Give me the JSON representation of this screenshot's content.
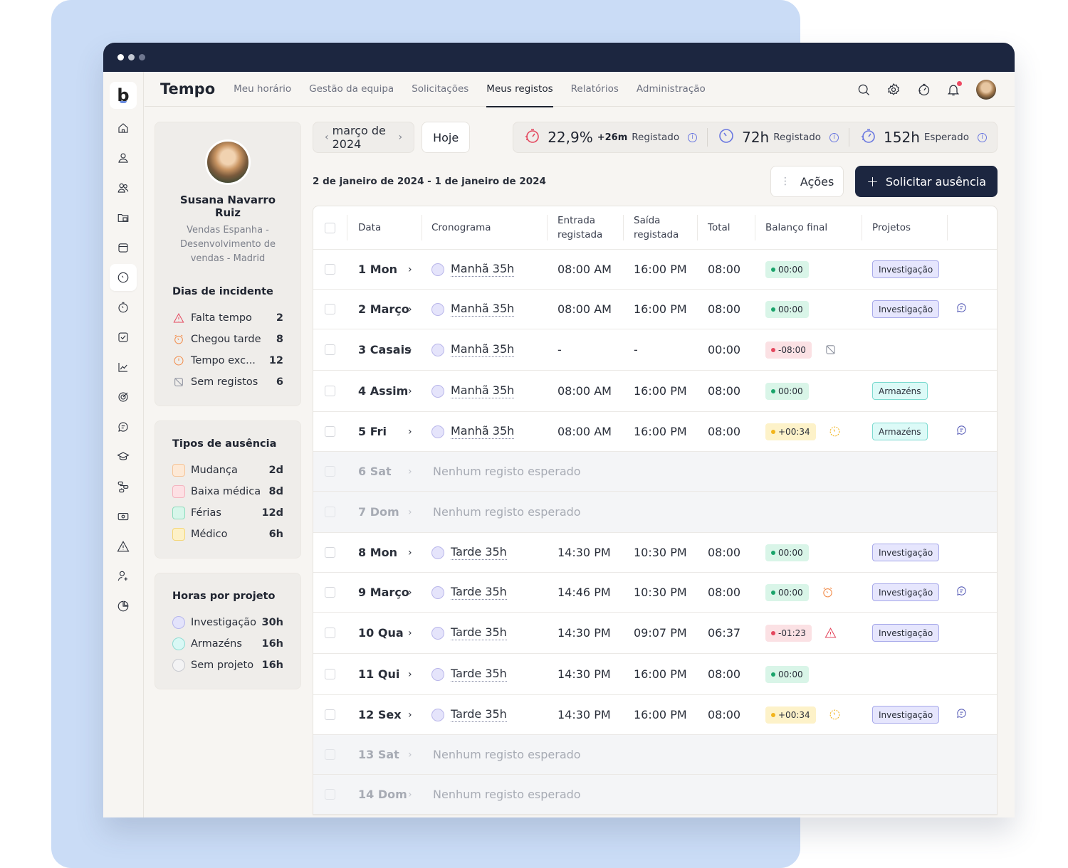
{
  "window": {
    "traffic_lights": [
      "close",
      "minimize",
      "maximize"
    ]
  },
  "brand": {
    "logo_letter": "b"
  },
  "rail": {
    "items": [
      {
        "icon": "home-icon"
      },
      {
        "icon": "user-icon"
      },
      {
        "icon": "users-icon"
      },
      {
        "icon": "folder-icon"
      },
      {
        "icon": "calendar-icon"
      },
      {
        "icon": "clock-icon",
        "active": true
      },
      {
        "icon": "stopwatch-icon"
      },
      {
        "icon": "checkbox-icon"
      },
      {
        "icon": "chart-line-icon"
      },
      {
        "icon": "target-icon"
      },
      {
        "icon": "chat-icon"
      },
      {
        "icon": "graduation-cap-icon"
      },
      {
        "icon": "workflow-icon"
      },
      {
        "icon": "money-icon"
      },
      {
        "icon": "warning-icon"
      },
      {
        "icon": "user-add-icon"
      },
      {
        "icon": "pie-chart-icon"
      }
    ]
  },
  "header": {
    "title": "Tempo",
    "tabs": [
      {
        "label": "Meu horário"
      },
      {
        "label": "Gestão da equipa"
      },
      {
        "label": "Solicitações"
      },
      {
        "label": "Meus registos",
        "active": true
      },
      {
        "label": "Relatórios"
      },
      {
        "label": "Administração"
      }
    ],
    "icons": [
      "search-icon",
      "gear-icon",
      "speedometer-icon",
      "bell-icon",
      "avatar"
    ],
    "notification_badge": true
  },
  "profile": {
    "name": "Susana Navarro Ruiz",
    "department": "Vendas Espanha - Desenvolvimento de vendas - Madrid"
  },
  "incidents": {
    "title": "Dias de incidente",
    "items": [
      {
        "label": "Falta tempo",
        "value": "2",
        "icon": "warning-icon",
        "color": "#e4475e"
      },
      {
        "label": "Chegou tarde",
        "value": "8",
        "icon": "alarm-icon",
        "color": "#f28c4a"
      },
      {
        "label": "Tempo exc...",
        "value": "12",
        "icon": "clock-icon",
        "color": "#f28c4a"
      },
      {
        "label": "Sem registos",
        "value": "6",
        "icon": "no-record-icon",
        "color": "#8a8f9c"
      }
    ]
  },
  "absence_types": {
    "title": "Tipos de ausência",
    "items": [
      {
        "label": "Mudança",
        "value": "2d",
        "fill": "#fde9d6",
        "border": "#f5c59a"
      },
      {
        "label": "Baixa médica",
        "value": "8d",
        "fill": "#fde0e4",
        "border": "#f4b4bf"
      },
      {
        "label": "Férias",
        "value": "12d",
        "fill": "#d7f6ea",
        "border": "#8fdcbe"
      },
      {
        "label": "Médico",
        "value": "6h",
        "fill": "#fdf1c7",
        "border": "#f4d678"
      }
    ]
  },
  "project_hours": {
    "title": "Horas por projeto",
    "items": [
      {
        "label": "Investigação",
        "value": "30h",
        "fill": "#e3e3fb",
        "border": "#b6b6ec"
      },
      {
        "label": "Armazéns",
        "value": "16h",
        "fill": "#d9f8f5",
        "border": "#8fdcd3"
      },
      {
        "label": "Sem projeto",
        "value": "16h",
        "fill": "#f3f3f4",
        "border": "#c8cad0"
      }
    ]
  },
  "toolbar": {
    "month": "março de 2024",
    "today_label": "Hoje",
    "range": "2 de janeiro de 2024 - 1 de janeiro de 2024",
    "actions_label": "Ações",
    "request_label": "Solicitar ausência"
  },
  "stats": [
    {
      "value": "22,9%",
      "delta": "+26m",
      "label": "Registado",
      "icon_color": "#e4475e"
    },
    {
      "value": "72h",
      "label": "Registado",
      "icon_color": "#6a78e0"
    },
    {
      "value": "152h",
      "label": "Esperado",
      "icon_color": "#6a78e0"
    }
  ],
  "table": {
    "columns": [
      "Data",
      "Cronograma",
      "Entrada registada",
      "Saída registada",
      "Total",
      "Balanço final",
      "Projetos"
    ],
    "rows": [
      {
        "date": "1 Mon",
        "schedule": "Manhã 35h",
        "in": "08:00 AM",
        "out": "16:00 PM",
        "total": "08:00",
        "balance": "00:00",
        "bal_type": "ok",
        "project": "Investigação",
        "proj_type": "inv"
      },
      {
        "date": "2 Março",
        "schedule": "Manhã 35h",
        "in": "08:00 AM",
        "out": "16:00 PM",
        "total": "08:00",
        "balance": "00:00",
        "bal_type": "ok",
        "project": "Investigação",
        "proj_type": "inv",
        "comment": true
      },
      {
        "date": "3 Casais",
        "schedule": "Manhã 35h",
        "in": "-",
        "out": "-",
        "total": "00:00",
        "balance": "-08:00",
        "bal_type": "neg",
        "incident": "no-record",
        "tall": true
      },
      {
        "date": "4 Assim",
        "schedule": "Manhã 35h",
        "in": "08:00 AM",
        "out": "16:00 PM",
        "total": "08:00",
        "balance": "00:00",
        "bal_type": "ok",
        "project": "Armazéns",
        "proj_type": "arm",
        "tall": true
      },
      {
        "date": "5 Fri",
        "schedule": "Manhã 35h",
        "in": "08:00 AM",
        "out": "16:00 PM",
        "total": "08:00",
        "balance": "+00:34",
        "bal_type": "pos",
        "incident": "overtime",
        "project": "Armazéns",
        "proj_type": "arm",
        "comment": true
      },
      {
        "date": "6 Sat",
        "off": true,
        "note": "Nenhum registo esperado"
      },
      {
        "date": "7 Dom",
        "off": true,
        "note": "Nenhum registo esperado",
        "tall": true
      },
      {
        "date": "8 Mon",
        "schedule": "Tarde 35h",
        "in": "14:30 PM",
        "out": "10:30 PM",
        "total": "08:00",
        "balance": "00:00",
        "bal_type": "ok",
        "project": "Investigação",
        "proj_type": "inv"
      },
      {
        "date": "9 Março",
        "schedule": "Tarde 35h",
        "in": "14:46 PM",
        "out": "10:30 PM",
        "total": "08:00",
        "balance": "00:00",
        "bal_type": "ok",
        "incident": "late",
        "project": "Investigação",
        "proj_type": "inv",
        "comment": true
      },
      {
        "date": "10 Qua",
        "schedule": "Tarde 35h",
        "in": "14:30 PM",
        "out": "09:07 PM",
        "total": "06:37",
        "balance": "-01:23",
        "bal_type": "neg",
        "incident": "missing",
        "project": "Investigação",
        "proj_type": "inv",
        "tall": true
      },
      {
        "date": "11 Qui",
        "schedule": "Tarde 35h",
        "in": "14:30 PM",
        "out": "16:00 PM",
        "total": "08:00",
        "balance": "00:00",
        "bal_type": "ok",
        "tall": true
      },
      {
        "date": "12 Sex",
        "schedule": "Tarde 35h",
        "in": "14:30 PM",
        "out": "16:00 PM",
        "total": "08:00",
        "balance": "+00:34",
        "bal_type": "pos",
        "incident": "overtime",
        "project": "Investigação",
        "proj_type": "inv",
        "comment": true
      },
      {
        "date": "13 Sat",
        "off": true,
        "note": "Nenhum registo esperado"
      },
      {
        "date": "14 Dom",
        "off": true,
        "note": "Nenhum registo esperado"
      }
    ]
  }
}
